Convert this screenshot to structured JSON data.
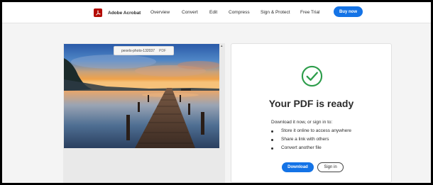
{
  "nav": {
    "brand": "Adobe Acrobat",
    "links": [
      {
        "label": "Overview"
      },
      {
        "label": "Convert"
      },
      {
        "label": "Edit"
      },
      {
        "label": "Compress"
      },
      {
        "label": "Sign & Protect"
      },
      {
        "label": "Free Trial"
      }
    ],
    "buy_label": "Buy now"
  },
  "preview": {
    "file_name": "pexels-photo-132037",
    "file_ext": "PDF",
    "scroll_arrow": "▴"
  },
  "ready": {
    "title": "Your PDF is ready",
    "intro": "Download it now, or sign in to:",
    "bullets": [
      "Store it online to access anywhere",
      "Share a link with others",
      "Convert another file"
    ],
    "download_label": "Download",
    "signin_label": "Sign in"
  },
  "colors": {
    "accent": "#1473e6",
    "brand": "#b30b00",
    "success": "#2d9d4b"
  }
}
